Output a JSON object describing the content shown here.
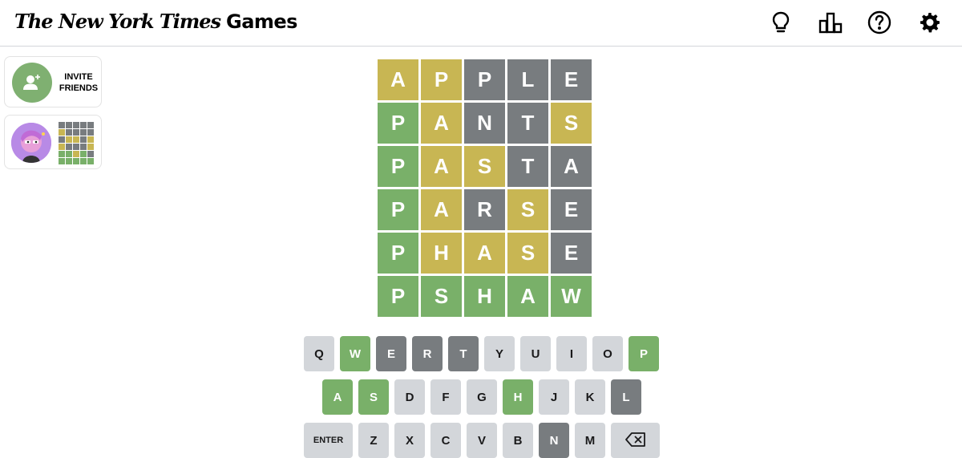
{
  "header": {
    "logo_brand": "The New York Times",
    "logo_product": "Games",
    "icons": [
      "hint-lightbulb-icon",
      "stats-bar-chart-icon",
      "help-question-icon",
      "settings-gear-icon"
    ]
  },
  "sidebar": {
    "invite_label_line1": "INVITE",
    "invite_label_line2": "FRIENDS",
    "friend_mini_grid": [
      [
        "gray",
        "gray",
        "gray",
        "gray",
        "gray"
      ],
      [
        "yellow",
        "gray",
        "gray",
        "gray",
        "gray"
      ],
      [
        "gray",
        "yellow",
        "yellow",
        "gray",
        "yellow"
      ],
      [
        "yellow",
        "gray",
        "gray",
        "gray",
        "yellow"
      ],
      [
        "green",
        "green",
        "yellow",
        "green",
        "gray"
      ],
      [
        "green",
        "green",
        "green",
        "green",
        "green"
      ]
    ]
  },
  "colors": {
    "green": "#79b069",
    "yellow": "#c8b653",
    "gray": "#787c7f",
    "key_default": "#d3d6da",
    "border": "#d3d6da"
  },
  "board": [
    [
      {
        "letter": "A",
        "state": "yellow"
      },
      {
        "letter": "P",
        "state": "yellow"
      },
      {
        "letter": "P",
        "state": "gray"
      },
      {
        "letter": "L",
        "state": "gray"
      },
      {
        "letter": "E",
        "state": "gray"
      }
    ],
    [
      {
        "letter": "P",
        "state": "green"
      },
      {
        "letter": "A",
        "state": "yellow"
      },
      {
        "letter": "N",
        "state": "gray"
      },
      {
        "letter": "T",
        "state": "gray"
      },
      {
        "letter": "S",
        "state": "yellow"
      }
    ],
    [
      {
        "letter": "P",
        "state": "green"
      },
      {
        "letter": "A",
        "state": "yellow"
      },
      {
        "letter": "S",
        "state": "yellow"
      },
      {
        "letter": "T",
        "state": "gray"
      },
      {
        "letter": "A",
        "state": "gray"
      }
    ],
    [
      {
        "letter": "P",
        "state": "green"
      },
      {
        "letter": "A",
        "state": "yellow"
      },
      {
        "letter": "R",
        "state": "gray"
      },
      {
        "letter": "S",
        "state": "yellow"
      },
      {
        "letter": "E",
        "state": "gray"
      }
    ],
    [
      {
        "letter": "P",
        "state": "green"
      },
      {
        "letter": "H",
        "state": "yellow"
      },
      {
        "letter": "A",
        "state": "yellow"
      },
      {
        "letter": "S",
        "state": "yellow"
      },
      {
        "letter": "E",
        "state": "gray"
      }
    ],
    [
      {
        "letter": "P",
        "state": "green"
      },
      {
        "letter": "S",
        "state": "green"
      },
      {
        "letter": "H",
        "state": "green"
      },
      {
        "letter": "A",
        "state": "green"
      },
      {
        "letter": "W",
        "state": "green"
      }
    ]
  ],
  "keyboard": {
    "rows": [
      [
        {
          "label": "Q",
          "state": "default"
        },
        {
          "label": "W",
          "state": "green"
        },
        {
          "label": "E",
          "state": "gray"
        },
        {
          "label": "R",
          "state": "gray"
        },
        {
          "label": "T",
          "state": "gray"
        },
        {
          "label": "Y",
          "state": "default"
        },
        {
          "label": "U",
          "state": "default"
        },
        {
          "label": "I",
          "state": "default"
        },
        {
          "label": "O",
          "state": "default"
        },
        {
          "label": "P",
          "state": "green"
        }
      ],
      [
        {
          "label": "A",
          "state": "green"
        },
        {
          "label": "S",
          "state": "green"
        },
        {
          "label": "D",
          "state": "default"
        },
        {
          "label": "F",
          "state": "default"
        },
        {
          "label": "G",
          "state": "default"
        },
        {
          "label": "H",
          "state": "green"
        },
        {
          "label": "J",
          "state": "default"
        },
        {
          "label": "K",
          "state": "default"
        },
        {
          "label": "L",
          "state": "gray"
        }
      ],
      [
        {
          "label": "ENTER",
          "state": "default",
          "wide": true
        },
        {
          "label": "Z",
          "state": "default"
        },
        {
          "label": "X",
          "state": "default"
        },
        {
          "label": "C",
          "state": "default"
        },
        {
          "label": "V",
          "state": "default"
        },
        {
          "label": "B",
          "state": "default"
        },
        {
          "label": "N",
          "state": "gray"
        },
        {
          "label": "M",
          "state": "default"
        },
        {
          "label": "",
          "icon": "backspace-icon",
          "state": "default",
          "wide": true
        }
      ]
    ]
  }
}
